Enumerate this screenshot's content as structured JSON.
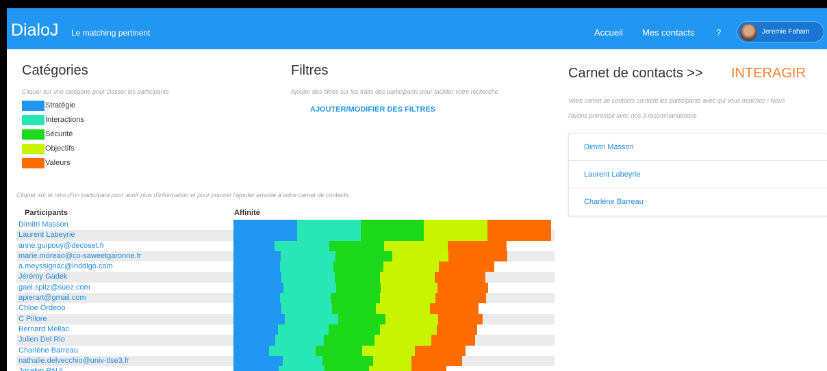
{
  "header": {
    "brand": "DialoJ",
    "tagline": "Le matching pertinent",
    "nav": [
      "Accueil",
      "Mes contacts",
      "?"
    ],
    "user_name": "Jeremie Faham"
  },
  "categories": {
    "title": "Catégories",
    "hint": "Cliquer sur une catégorie pour classer les participants",
    "items": [
      {
        "label": "Stratégie",
        "color": "#2196f3"
      },
      {
        "label": "Interactions",
        "color": "#29e6b5"
      },
      {
        "label": "Sécurité",
        "color": "#1bd81b"
      },
      {
        "label": "Objectifs",
        "color": "#c9f400"
      },
      {
        "label": "Valeurs",
        "color": "#ff6d00"
      }
    ]
  },
  "filters": {
    "title": "Filtres",
    "hint": "Ajouter des filtres sur les traits des participants pour faciliter votre recherche",
    "button": "AJOUTER/MODIFIER DES FILTRES"
  },
  "carnet": {
    "title": "Carnet de contacts >>",
    "action": "INTERAGIR",
    "hint_line1": "Votre carnet de contacts contient les participants avec qui vous matchez ! Nous",
    "hint_line2": "l'avons prérempli avec nos 3 recommandations",
    "contacts": [
      "Dimitri Masson",
      "Laurent Labeyrie",
      "Charlène Barreau"
    ]
  },
  "participants": {
    "hint": "Cliquer sur le nom d'un participant pour avoir plus d'information et pour pouvoir l'ajouter ensuite à votre carnet de contacts",
    "col_name": "Participants",
    "col_affinity": "Affinité",
    "rows": [
      {
        "name": "Dimitri Masson",
        "scores": [
          91,
          91,
          91,
          91,
          91
        ]
      },
      {
        "name": "Laurent Labeyrie",
        "scores": [
          91,
          91,
          91,
          91,
          91
        ]
      },
      {
        "name": "anne.guipouy@decoset.fr",
        "scores": [
          59,
          78,
          79,
          91,
          84
        ]
      },
      {
        "name": "marie.moreao@co-saweetgaronne.fr",
        "scores": [
          68,
          78,
          81,
          81,
          84
        ]
      },
      {
        "name": "a.meyssignac@inddigo.com",
        "scores": [
          67,
          76,
          72,
          79,
          80
        ]
      },
      {
        "name": "Jérémy Gadek",
        "scores": [
          69,
          76,
          65,
          78,
          73
        ]
      },
      {
        "name": "gael.spitz@suez.com",
        "scores": [
          72,
          75,
          64,
          81,
          73
        ]
      },
      {
        "name": "apierart@gmail.com",
        "scores": [
          67,
          72,
          71,
          79,
          73
        ]
      },
      {
        "name": "Chloe Ordeoo",
        "scores": [
          69,
          72,
          63,
          77,
          70
        ]
      },
      {
        "name": "C Pillore",
        "scores": [
          74,
          76,
          68,
          75,
          64
        ]
      },
      {
        "name": "Bernard Mellac",
        "scores": [
          64,
          72,
          74,
          81,
          58
        ]
      },
      {
        "name": "Julien Del Rio",
        "scores": [
          60,
          69,
          73,
          81,
          63
        ]
      },
      {
        "name": "Charlène Barreau",
        "scores": [
          51,
          67,
          66,
          76,
          72
        ]
      },
      {
        "name": "nathalie.delvecchio@univ-tlse3.fr",
        "scores": [
          71,
          56,
          73,
          55,
          72
        ]
      },
      {
        "name": "Jocelyn PAUL",
        "scores": [
          65,
          65,
          64,
          61,
          50
        ]
      }
    ]
  }
}
